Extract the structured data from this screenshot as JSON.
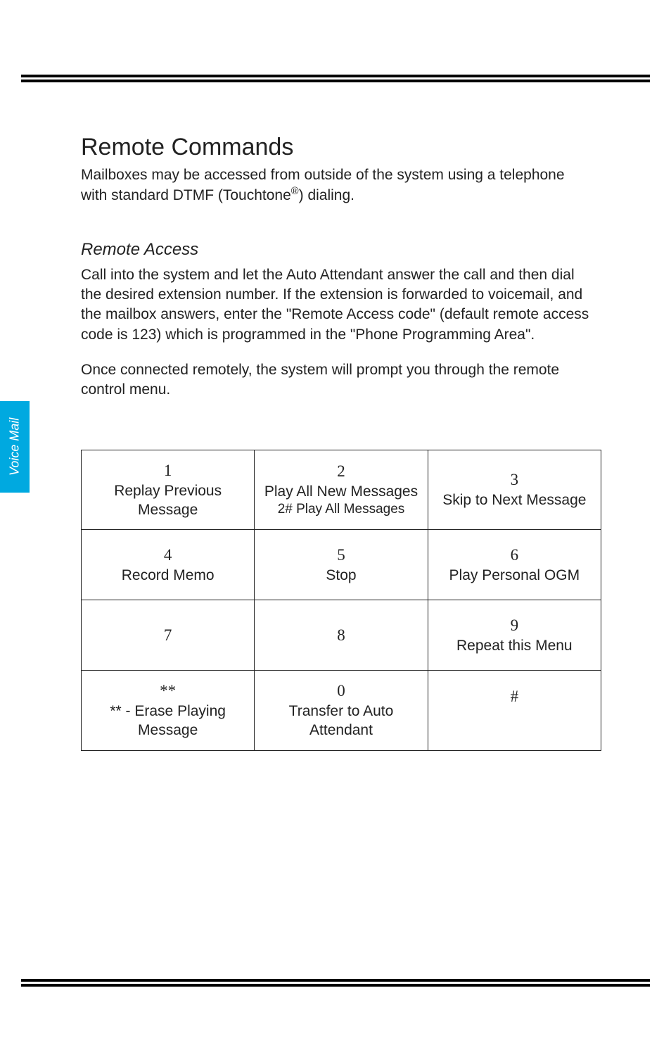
{
  "side_tab": "Voice Mail",
  "section": {
    "title": "Remote Commands",
    "intro_1": "Mailboxes may be accessed from outside of the system using a telephone with standard DTMF (Touchtone",
    "intro_sup": "®",
    "intro_2": ") dialing."
  },
  "subsection": {
    "title": "Remote Access",
    "p1": "Call into the system and let the Auto Attendant answer the call and then dial the desired extension number. If the extension is forwarded to voicemail, and the mailbox answers, enter the \"Remote Access code\" (default remote access code is 123) which is programmed in the \"Phone Programming Area\".",
    "p2": "Once connected remotely, the system will prompt you through the remote control menu."
  },
  "keypad": [
    [
      {
        "num": "1",
        "label": "Replay Previous Message",
        "sub": ""
      },
      {
        "num": "2",
        "label": "Play All New Messages",
        "sub": "2# Play All Messages"
      },
      {
        "num": "3",
        "label": "Skip to Next Message",
        "sub": ""
      }
    ],
    [
      {
        "num": "4",
        "label": "Record Memo",
        "sub": ""
      },
      {
        "num": "5",
        "label": "Stop",
        "sub": ""
      },
      {
        "num": "6",
        "label": "Play Personal OGM",
        "sub": ""
      }
    ],
    [
      {
        "num": "7",
        "label": "",
        "sub": ""
      },
      {
        "num": "8",
        "label": "",
        "sub": ""
      },
      {
        "num": "9",
        "label": "Repeat this Menu",
        "sub": ""
      }
    ],
    [
      {
        "num": "**",
        "label": "** - Erase Playing Message",
        "sub": ""
      },
      {
        "num": "0",
        "label": "Transfer to Auto Attendant",
        "sub": ""
      },
      {
        "num": "#",
        "label": "",
        "sub": ""
      }
    ]
  ]
}
